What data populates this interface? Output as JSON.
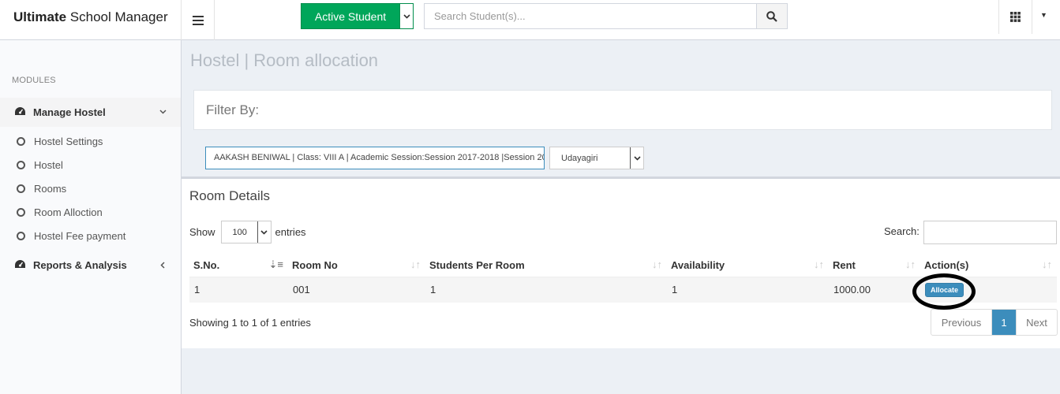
{
  "header": {
    "brand_bold": "Ultimate",
    "brand_rest": " School Manager",
    "active_student_label": "Active Student",
    "search_placeholder": "Search Student(s)..."
  },
  "sidebar": {
    "section_header": "MODULES",
    "menu1": {
      "label": "Manage Hostel",
      "items": [
        "Hostel Settings",
        "Hostel",
        "Rooms",
        "Room Alloction",
        "Hostel Fee payment"
      ]
    },
    "menu2": {
      "label": "Reports & Analysis"
    }
  },
  "main": {
    "page_title": "Hostel | Room allocation",
    "filter_label": "Filter By:",
    "student_select_value": "AAKASH BENIWAL | Class: VIII A | Academic Session:Session 2017-2018 |Session 201",
    "hostel_select_value": "Udayagiri"
  },
  "room_details": {
    "title": "Room Details",
    "show_label": "Show",
    "entries_value": "100",
    "entries_label": "entries",
    "search_label": "Search:",
    "columns": [
      "S.No.",
      "Room No",
      "Students Per Room",
      "Availability",
      "Rent",
      "Action(s)"
    ],
    "rows": [
      {
        "sno": "1",
        "room_no": "001",
        "students_per_room": "1",
        "availability": "1",
        "rent": "1000.00",
        "action": "Allocate"
      }
    ],
    "info": "Showing 1 to 1 of 1 entries",
    "pager": {
      "previous": "Previous",
      "page": "1",
      "next": "Next"
    }
  },
  "colors": {
    "primary": "#3c8dbc",
    "success": "#00a65a"
  }
}
